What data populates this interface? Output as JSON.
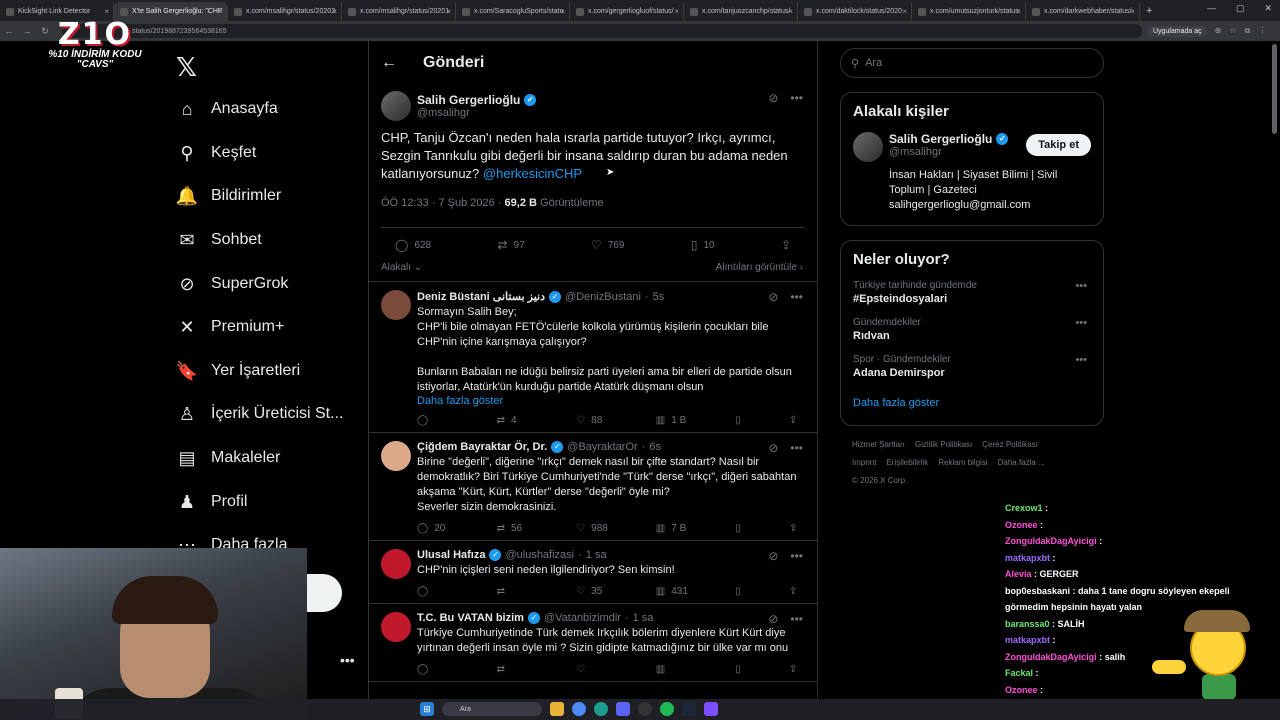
{
  "browser": {
    "tabs": [
      {
        "label": "KickSight Link Detector"
      },
      {
        "label": "X'te Salih Gergerlioğlu: \"CHP"
      },
      {
        "label": "x.com/msalihgr/status/20202"
      },
      {
        "label": "x.com/msalihgr/status/20201"
      },
      {
        "label": "x.com/SaracogluSports/statu"
      },
      {
        "label": "x.com/gergerliogluof/status/"
      },
      {
        "label": "x.com/tanjuozcanchp/status/"
      },
      {
        "label": "x.com/daktilock/status/2020"
      },
      {
        "label": "x.com/umutsuzjonturk/status"
      },
      {
        "label": "x.com/darkwebhaber/status/"
      }
    ],
    "new_tab": "+",
    "url": "status/2019887239564538165",
    "app_button": "Uygulamada aç"
  },
  "overlay": {
    "logo_big": "Z1O",
    "logo_small_1": "%10 İNDİRİM KODU",
    "logo_small_2": "\"CAVS\""
  },
  "nav": {
    "items": [
      {
        "label": "Anasayfa",
        "icon": "home-icon",
        "glyph": "⌂"
      },
      {
        "label": "Keşfet",
        "icon": "search-icon",
        "glyph": "⚲"
      },
      {
        "label": "Bildirimler",
        "icon": "bell-icon",
        "glyph": "🔔"
      },
      {
        "label": "Sohbet",
        "icon": "mail-icon",
        "glyph": "✉"
      },
      {
        "label": "SuperGrok",
        "icon": "grok-icon",
        "glyph": "⊘"
      },
      {
        "label": "Premium+",
        "icon": "x-premium-icon",
        "glyph": "✕"
      },
      {
        "label": "Yer İşaretleri",
        "icon": "bookmark-icon",
        "glyph": "🔖"
      },
      {
        "label": "İçerik Üreticisi St...",
        "icon": "creator-icon",
        "glyph": "♙"
      },
      {
        "label": "Makaleler",
        "icon": "article-icon",
        "glyph": "▤"
      },
      {
        "label": "Profil",
        "icon": "profile-icon",
        "glyph": "♟"
      },
      {
        "label": "Daha fazla",
        "icon": "more-icon",
        "glyph": "⋯"
      }
    ]
  },
  "header": {
    "title": "Gönderi"
  },
  "main_tweet": {
    "name": "Salih Gergerlioğlu",
    "handle": "@msalihgr",
    "text": "CHP, Tanju Özcan'ı neden hala ısrarla partide tutuyor? Irkçı, ayrımcı, Sezgin Tanrıkulu gibi değerli bir insana saldırıp duran bu adama neden katlanıyorsunuz?",
    "mention": "@herkesicinCHP",
    "time": "ÖÖ 12:33 · 7 Şub 2026 ·",
    "views": "69,2 B",
    "views_label": "Görüntüleme",
    "replies": "628",
    "reposts": "97",
    "likes": "769",
    "bookmarks": "10",
    "related": "Alakalı",
    "quotes": "Alıntıları görüntüle"
  },
  "replies": [
    {
      "name": "Deniz Büstani دنیز بستانی",
      "handle": "@DenizBustani",
      "time": "5s",
      "text": "Sormayın Salih Bey;\nCHP'li bile olmayan FETÖ'cülerle kolkola yürümüş kişilerin çocukları bile CHP'nin içine karışmaya çalışıyor?\n\nBunların Babaları ne idüğü belirsiz parti üyeleri ama  bir elleri de partide olsun istiyorlar, Atatürk'ün kurduğu partide Atatürk düşmanı olsun",
      "show_more": "Daha fazla göster",
      "replies": "",
      "reposts": "4",
      "likes": "88",
      "views": "1 B",
      "avatar_color": "#7a4a3a"
    },
    {
      "name": "Çiğdem Bayraktar Ör, Dr.",
      "handle": "@BayraktarOr",
      "time": "6s",
      "text": "Birine \"değerli\", diğerine \"ırkçı\" demek nasıl bir çifte standart? Nasıl bir demokratlık? Biri Türkiye Cumhuriyeti'nde \"Türk\" derse \"ırkçı\", diğeri sabahtan akşama \"Kürt, Kürt, Kürtler\" derse \"değerli\" öyle mi?\nSeverler sizin demokrasinizi.",
      "show_more": "",
      "replies": "20",
      "reposts": "56",
      "likes": "988",
      "views": "7 B",
      "avatar_color": "#d9a98a"
    },
    {
      "name": "Ulusal Hafıza",
      "handle": "@ulushafizasi",
      "time": "1 sa",
      "text": "CHP'nin içişleri seni neden ilgilendiriyor? Sen kimsin!",
      "show_more": "",
      "replies": "",
      "reposts": "",
      "likes": "35",
      "views": "431",
      "avatar_color": "#c0192b"
    },
    {
      "name": "T.C. Bu VATAN bizim",
      "handle": "@Vatanbizimdir",
      "time": "1 sa",
      "text": "Türkiye Cumhuriyetinde Türk demek Irkçılık bölerim diyenlere Kürt Kürt diye yırtınan değerli insan öyle mi ? Sizin gidipte katmadığınız bir ülke var mı onu",
      "show_more": "",
      "replies": "",
      "reposts": "",
      "likes": "",
      "views": "",
      "avatar_color": "#c0192b"
    }
  ],
  "right": {
    "search_placeholder": "Ara",
    "people_title": "Alakalı kişiler",
    "person_name": "Salih Gergerlioğlu",
    "person_handle": "@msalihgr",
    "follow": "Takip et",
    "bio": "İnsan Hakları | Siyaset Bilimi | Sivil Toplum | Gazeteci salihgergerlioglu@gmail.com",
    "trends_title": "Neler oluyor?",
    "trends": [
      {
        "context": "Türkiye tarihinde gündemde",
        "name": "#Epsteindosyalari"
      },
      {
        "context": "Gündemdekiler",
        "name": "Rıdvan"
      },
      {
        "context": "Spor · Gündemdekiler",
        "name": "Adana Demirspor"
      }
    ],
    "show_more": "Daha fazla göster",
    "footer_1": [
      "Hizmet Şartları",
      "Gizlilik Politikası",
      "Çerez Politikası"
    ],
    "footer_2": [
      "Imprint",
      "Erişilebilirlik",
      "Reklam bilgisi",
      "Daha fazla ..."
    ],
    "copyright": "© 2026 X Corp."
  },
  "chat": [
    {
      "user": "Crexow1",
      "text": ":",
      "cls": "g"
    },
    {
      "user": "Ozonee",
      "text": ":",
      "cls": "p"
    },
    {
      "user": "ZonguldakDagAyicigi",
      "text": ":",
      "cls": "p"
    },
    {
      "user": "matkapxbt",
      "text": ":",
      "cls": ""
    },
    {
      "user": "Alevia",
      "text": ": GERGER",
      "cls": "p"
    },
    {
      "user": "bop0esbaskani",
      "text": ": daha 1 tane dogru söyleyen ekepeli",
      "cls": "ct"
    },
    {
      "user": "",
      "text": "görmedim hepsinin hayatı yalan",
      "cls": "ct"
    },
    {
      "user": "baranssa0",
      "text": ": SALİH",
      "cls": "g"
    },
    {
      "user": "matkapxbt",
      "text": ":",
      "cls": ""
    },
    {
      "user": "ZonguldakDagAyicigi",
      "text": ": salih",
      "cls": "p"
    },
    {
      "user": "Fackal",
      "text": ":",
      "cls": "g"
    },
    {
      "user": "Ozonee",
      "text": ":",
      "cls": "p"
    }
  ],
  "taskbar": {
    "search": "Ara"
  }
}
